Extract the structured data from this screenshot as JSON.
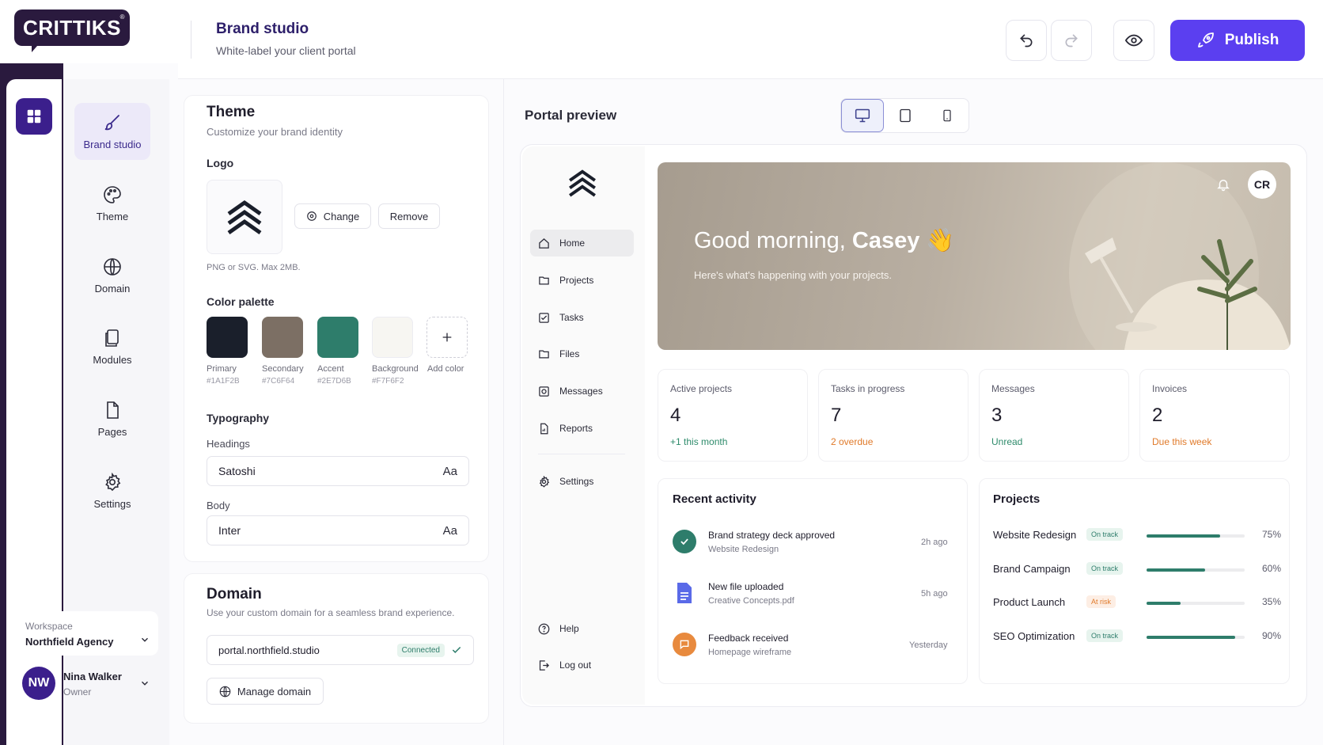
{
  "brand": {
    "logo_text": "CRITTIKS",
    "registered": "®"
  },
  "header": {
    "title": "Brand studio",
    "subtitle": "White-label your client portal",
    "publish_label": "Publish"
  },
  "nav": {
    "items": [
      {
        "label": "Brand studio",
        "icon": "brush-icon"
      },
      {
        "label": "Theme",
        "icon": "palette-icon"
      },
      {
        "label": "Domain",
        "icon": "globe-icon"
      },
      {
        "label": "Modules",
        "icon": "modules-icon"
      },
      {
        "label": "Pages",
        "icon": "page-icon"
      },
      {
        "label": "Settings",
        "icon": "gear-icon"
      }
    ],
    "workspace_label": "Workspace",
    "workspace_name": "Northfield Agency",
    "user": {
      "initials": "NW",
      "name": "Nina Walker",
      "role": "Owner"
    }
  },
  "theme": {
    "title": "Theme",
    "subtitle": "Customize your brand identity",
    "logo_label": "Logo",
    "change_label": "Change",
    "remove_label": "Remove",
    "logo_hint": "PNG or SVG. Max 2MB.",
    "palette_label": "Color palette",
    "swatches": [
      {
        "name": "Primary",
        "hex": "#1A1F2B",
        "color": "#1a1f2b"
      },
      {
        "name": "Secondary",
        "hex": "#7C6F64",
        "color": "#7c6f64"
      },
      {
        "name": "Accent",
        "hex": "#2E7D6B",
        "color": "#2e7d6b"
      },
      {
        "name": "Background",
        "hex": "#F7F6F2",
        "color": "#f7f6f2"
      }
    ],
    "add_color_label": "Add color",
    "typography_label": "Typography",
    "headings_label": "Headings",
    "headings_font": "Satoshi",
    "body_label": "Body",
    "body_font": "Inter",
    "font_sample": "Aa"
  },
  "domain": {
    "title": "Domain",
    "subtitle": "Use your custom domain for a seamless brand experience.",
    "value": "portal.northfield.studio",
    "status": "Connected",
    "manage_label": "Manage domain"
  },
  "preview": {
    "title": "Portal preview",
    "nav": [
      {
        "label": "Home",
        "icon": "home-icon"
      },
      {
        "label": "Projects",
        "icon": "folder-icon"
      },
      {
        "label": "Tasks",
        "icon": "checkbox-icon"
      },
      {
        "label": "Files",
        "icon": "folder-icon"
      },
      {
        "label": "Messages",
        "icon": "message-icon"
      },
      {
        "label": "Reports",
        "icon": "report-icon"
      },
      {
        "label": "Settings",
        "icon": "gear-icon"
      }
    ],
    "help_label": "Help",
    "logout_label": "Log out",
    "avatar": "CR",
    "greeting": "Good morning,",
    "greeting_name": "Casey",
    "wave": "👋",
    "hero_sub": "Here's what's happening with your projects.",
    "stats": [
      {
        "label": "Active projects",
        "value": "4",
        "note": "+1 this month",
        "note_color": "#2e8b6b"
      },
      {
        "label": "Tasks in progress",
        "value": "7",
        "note": "2 overdue",
        "note_color": "#e07a2a"
      },
      {
        "label": "Messages",
        "value": "3",
        "note": "Unread",
        "note_color": "#2e8b6b"
      },
      {
        "label": "Invoices",
        "value": "2",
        "note": "Due this week",
        "note_color": "#e07a2a"
      }
    ],
    "activity_title": "Recent activity",
    "activity": [
      {
        "title": "Brand strategy deck approved",
        "sub": "Website Redesign",
        "time": "2h ago"
      },
      {
        "title": "New file uploaded",
        "sub": "Creative Concepts.pdf",
        "time": "5h ago"
      },
      {
        "title": "Feedback received",
        "sub": "Homepage wireframe",
        "time": "Yesterday"
      }
    ],
    "projects_title": "Projects",
    "projects": [
      {
        "name": "Website Redesign",
        "status": "On track",
        "progress": 0.75,
        "pct": "75%"
      },
      {
        "name": "Brand Campaign",
        "status": "On track",
        "progress": 0.6,
        "pct": "60%"
      },
      {
        "name": "Product Launch",
        "status": "At risk",
        "progress": 0.35,
        "pct": "35%"
      },
      {
        "name": "SEO Optimization",
        "status": "On track",
        "progress": 0.9,
        "pct": "90%"
      }
    ]
  },
  "colors": {
    "accent": "#5b3ff0",
    "brand_dark": "#2a1a3e",
    "success": "#2e7d6b",
    "warning": "#e07a2a"
  }
}
